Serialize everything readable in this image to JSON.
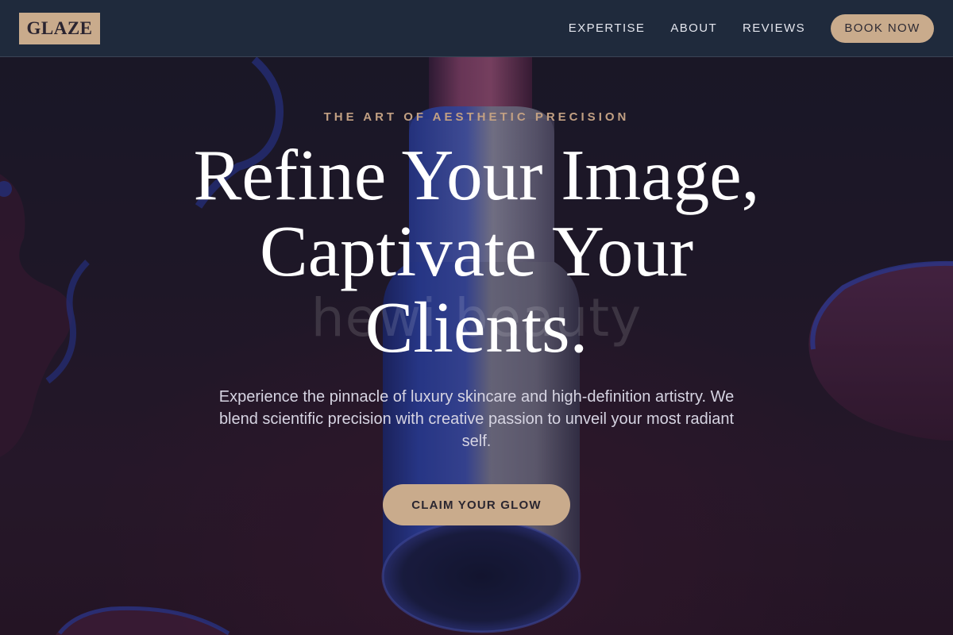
{
  "brand": {
    "logo_text": "GLAZE"
  },
  "nav": {
    "links": [
      "EXPERTISE",
      "ABOUT",
      "REVIEWS"
    ],
    "book_button": "BOOK NOW"
  },
  "hero": {
    "eyebrow": "THE ART OF AESTHETIC PRECISION",
    "title_lines": [
      "Refine Your Image,",
      "Captivate Your",
      "Clients."
    ],
    "watermark": "hewi beauty",
    "subtitle": "Experience the pinnacle of luxury skincare and high-definition artistry. We blend scientific precision with creative passion to unveil your most radiant self.",
    "cta": "CLAIM YOUR GLOW"
  },
  "colors": {
    "accent": "#c9ab8c",
    "nav_bg": "#1f2a3c",
    "eyebrow": "#c2a083",
    "hero_bg": "#1c1a28"
  }
}
